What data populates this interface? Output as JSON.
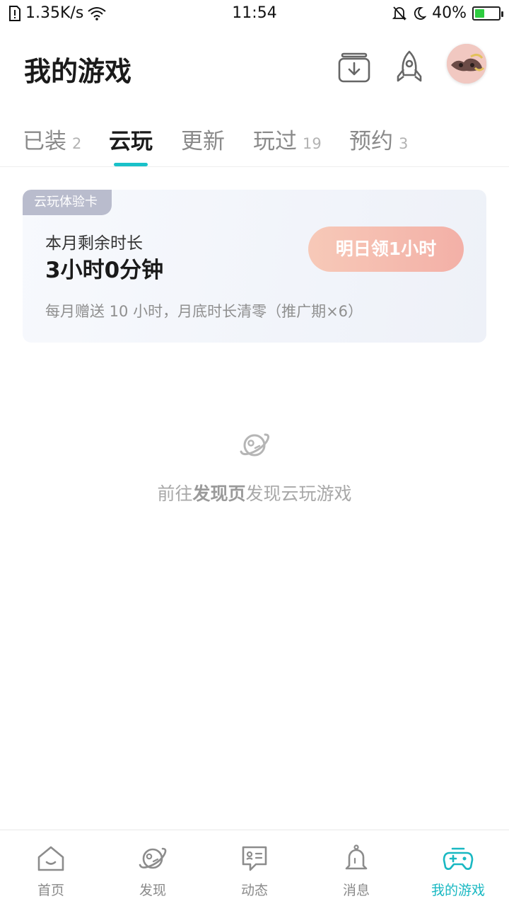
{
  "status_bar": {
    "speed": "1.35K/s",
    "time": "11:54",
    "battery": "40%",
    "battery_level": 0.4
  },
  "header": {
    "title": "我的游戏",
    "download_icon": "download-box-icon",
    "rocket_icon": "rocket-icon"
  },
  "tabs": [
    {
      "label": "已装",
      "count": "2"
    },
    {
      "label": "云玩",
      "count": ""
    },
    {
      "label": "更新",
      "count": ""
    },
    {
      "label": "玩过",
      "count": "19"
    },
    {
      "label": "预约",
      "count": "3"
    }
  ],
  "active_tab": "云玩",
  "cloud_card": {
    "tag": "云玩体验卡",
    "label": "本月剩余时长",
    "value": "3小时0分钟",
    "button": "明日领1小时",
    "note": "每月赠送 10 小时，月底时长清零（推广期×6）"
  },
  "empty_state": {
    "prefix": "前往",
    "link": "发现页",
    "suffix": "发现云玩游戏",
    "icon": "planet-icon"
  },
  "bottom_nav": [
    {
      "label": "首页",
      "icon": "home-icon"
    },
    {
      "label": "发现",
      "icon": "planet-icon"
    },
    {
      "label": "动态",
      "icon": "chat-bubble-icon"
    },
    {
      "label": "消息",
      "icon": "bell-icon"
    },
    {
      "label": "我的游戏",
      "icon": "gamepad-icon",
      "active": true
    }
  ],
  "colors": {
    "accent": "#19c1c9",
    "button_gradient_start": "#f7c9b8",
    "button_gradient_end": "#f3b0a7",
    "card_tag": "#b9bccd"
  }
}
